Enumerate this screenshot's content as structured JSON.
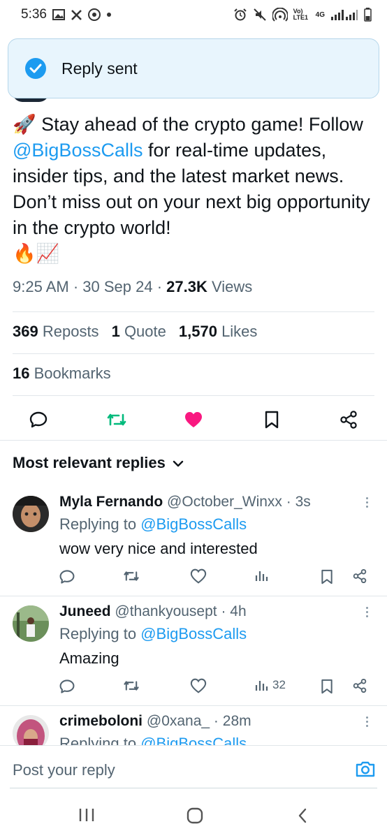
{
  "status_bar": {
    "time": "5:36",
    "network_label": "4G",
    "volte_label": "Vo) LTE1",
    "icons": [
      "gallery-icon",
      "x-app-icon",
      "chrome-icon",
      "dot-icon",
      "alarm-icon",
      "mute-icon",
      "hotspot-icon",
      "signal-icon",
      "battery-icon"
    ]
  },
  "toast": {
    "text": "Reply sent",
    "accent": "#1d9bf0"
  },
  "tweet": {
    "text_pre": " Stay ahead of the crypto game! Follow ",
    "mention": "@BigBossCalls",
    "text_post": " for real-time updates, insider tips, and the latest market news. Don’t miss out on your next big opportunity in the crypto world!",
    "emoji_rocket": "🚀",
    "emoji_fire": "🔥",
    "emoji_chart": "📈",
    "time": "9:25 AM",
    "date": "30 Sep 24",
    "views_count": "27.3K",
    "views_label": "Views",
    "reposts_count": "369",
    "reposts_label": "Reposts",
    "quotes_count": "1",
    "quotes_label": "Quote",
    "likes_count": "1,570",
    "likes_label": "Likes",
    "bookmarks_count": "16",
    "bookmarks_label": "Bookmarks",
    "liked": true,
    "colors": {
      "like": "#f91880",
      "repost": "#00ba7c",
      "link": "#1d9bf0"
    }
  },
  "sort": {
    "label": "Most relevant replies"
  },
  "replies": [
    {
      "name": "Myla Fernando",
      "handle": "@October_Winxx",
      "time": "3s",
      "replying_prefix": "Replying to",
      "replying_to": "@BigBossCalls",
      "body": "wow very nice and interested",
      "views": ""
    },
    {
      "name": "Juneed",
      "handle": "@thankyousept",
      "time": "4h",
      "replying_prefix": "Replying to",
      "replying_to": "@BigBossCalls",
      "body": "Amazing",
      "views": "32"
    },
    {
      "name": "crimeboloni",
      "handle": "@0xana_",
      "time": "28m",
      "replying_prefix": "Replying to",
      "replying_to": "@BigBossCalls"
    }
  ],
  "composer": {
    "placeholder": "Post your reply"
  }
}
